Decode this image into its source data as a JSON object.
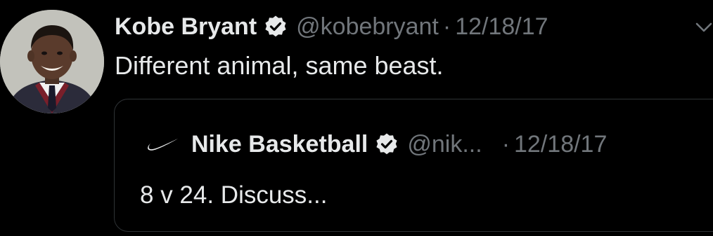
{
  "tweet": {
    "author_name": "Kobe Bryant",
    "handle": "@kobebryant",
    "separator": "·",
    "date": "12/18/17",
    "text": "Different animal, same beast.",
    "verified_icon": "verified-badge-icon",
    "menu_icon": "chevron-down-icon"
  },
  "quoted_tweet": {
    "author_name": "Nike Basketball",
    "handle": "@nik...",
    "separator": "·",
    "date": "12/18/17",
    "text": "8 v 24. Discuss...",
    "logo_icon": "nike-swoosh-icon"
  },
  "colors": {
    "background": "#000000",
    "primary_text": "#e7e9ea",
    "secondary_text": "#71767b",
    "border": "#2f3336"
  }
}
